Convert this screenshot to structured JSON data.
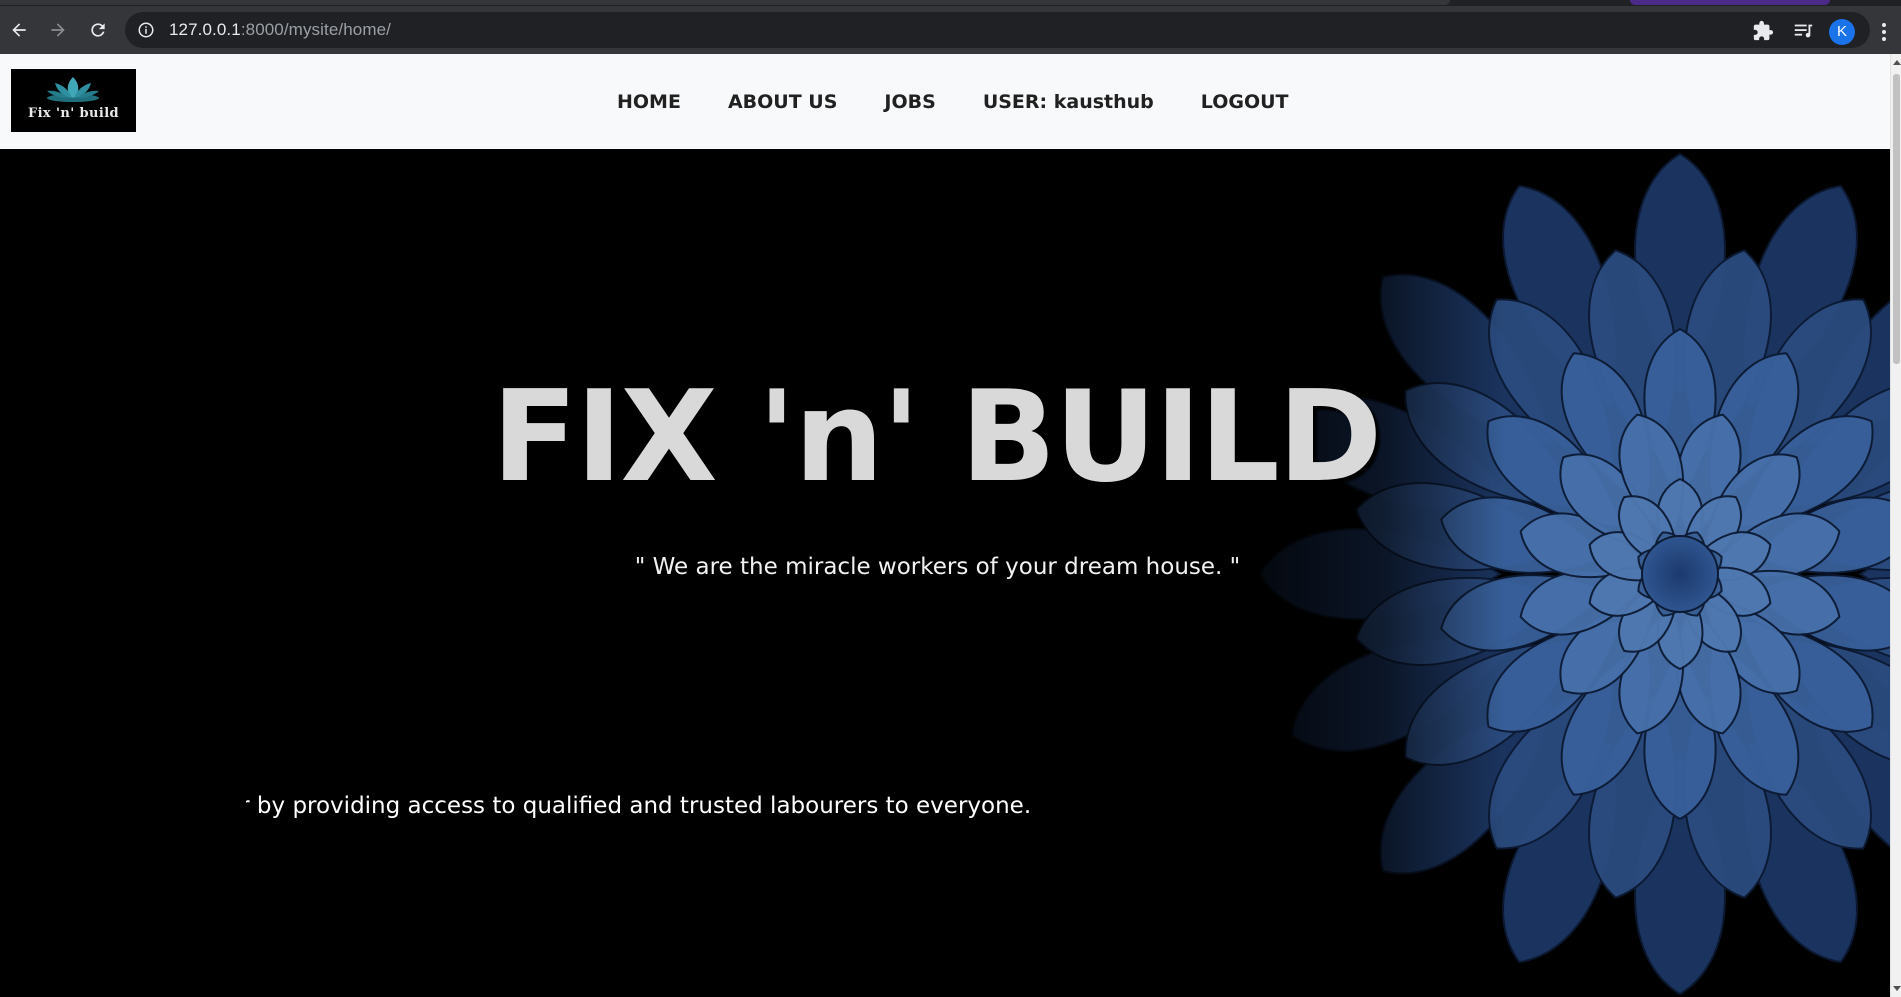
{
  "browser": {
    "url_host": "127.0.0.1",
    "url_path": ":8000/mysite/home/",
    "profile_initial": "K",
    "icons": [
      "back-arrow-icon",
      "forward-arrow-icon",
      "reload-icon",
      "info-icon",
      "star-icon",
      "extensions-icon",
      "media-queue-icon",
      "menu-kebab-icon"
    ]
  },
  "navbar": {
    "logo_text": "Fix 'n' build",
    "links": [
      {
        "label": "HOME"
      },
      {
        "label": "ABOUT US"
      },
      {
        "label": "JOBS"
      },
      {
        "label": "USER: kausthub"
      },
      {
        "label": "LOGOUT"
      }
    ]
  },
  "hero": {
    "title": "FIX 'n' BUILD",
    "tagline": "\" We are the miracle workers of your dream house. \"",
    "marquee_text": "er by providing access to qualified and trusted labourers to everyone."
  },
  "colors": {
    "chrome_bar": "#35363a",
    "omnibox": "#202124",
    "navbar_bg": "#f8f9fa",
    "hero_bg": "#000000",
    "title_color": "#d9d9d9",
    "flower_blue": "#3a5f94",
    "avatar_blue": "#1a73e8"
  }
}
